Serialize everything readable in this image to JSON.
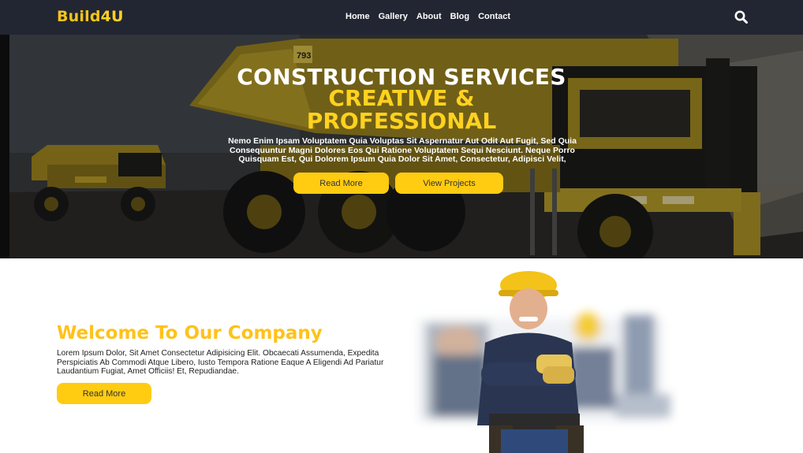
{
  "nav": {
    "logo_main": "Build",
    "logo_accent": "4U",
    "links": [
      "Home",
      "Gallery",
      "About",
      "Blog",
      "Contact"
    ],
    "search_icon": "search-icon"
  },
  "hero": {
    "title": "CONSTRUCTION SERVICES",
    "subtitle_line1": "CREATIVE &",
    "subtitle_line2": "PROFESSIONAL",
    "text": "Nemo Enim Ipsam Voluptatem Quia Voluptas Sit Aspernatur Aut Odit Aut Fugit, Sed Quia Consequuntur Magni Dolores Eos Qui Ratione Voluptatem Sequi Nesciunt. Neque Porro Quisquam Est, Qui Dolorem Ipsum Quia Dolor Sit Amet, Consectetur, Adipisci Velit,",
    "btn_read_more": "Read More",
    "btn_view_projects": "View Projects",
    "truck_number": "793"
  },
  "welcome": {
    "title": "Welcome To Our Company",
    "text": "Lorem Ipsum Dolor, Sit Amet Consectetur Adipisicing Elit. Obcaecati Assumenda, Expedita Perspiciatis Ab Commodi Atque Libero, Iusto Tempora Ratione Eaque A Eligendi Ad Pariatur Laudantium Fugiat, Amet Officiis! Et, Repudiandae.",
    "btn_read_more": "Read More"
  },
  "colors": {
    "navbar": "#222632",
    "accent": "#ffcc12",
    "title_yellow": "#ffc21a"
  }
}
